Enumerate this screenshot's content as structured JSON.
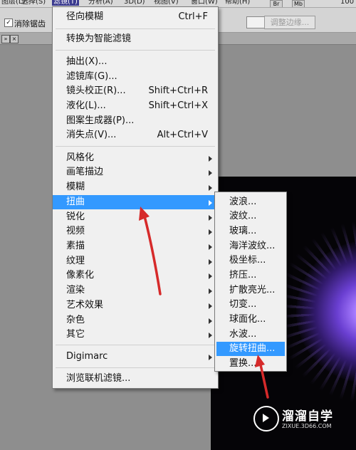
{
  "menubar": {
    "items": [
      "图层(L)",
      "选择(S)",
      "滤镜(T)",
      "分析(A)",
      "3D(D)",
      "视图(V)",
      "窗口(W)",
      "帮助(H)"
    ],
    "zoom": "100"
  },
  "options_bar": {
    "antialias_label": "消除锯齿",
    "refine_edge_label": "调整边缘..."
  },
  "filter_menu": {
    "items": [
      {
        "label": "径向模糊",
        "shortcut": "Ctrl+F"
      },
      {
        "label": "转换为智能滤镜"
      },
      {
        "label": "抽出(X)..."
      },
      {
        "label": "滤镜库(G)..."
      },
      {
        "label": "镜头校正(R)...",
        "shortcut": "Shift+Ctrl+R"
      },
      {
        "label": "液化(L)...",
        "shortcut": "Shift+Ctrl+X"
      },
      {
        "label": "图案生成器(P)..."
      },
      {
        "label": "消失点(V)...",
        "shortcut": "Alt+Ctrl+V"
      },
      {
        "label": "风格化"
      },
      {
        "label": "画笔描边"
      },
      {
        "label": "模糊"
      },
      {
        "label": "扭曲"
      },
      {
        "label": "锐化"
      },
      {
        "label": "视频"
      },
      {
        "label": "素描"
      },
      {
        "label": "纹理"
      },
      {
        "label": "像素化"
      },
      {
        "label": "渲染"
      },
      {
        "label": "艺术效果"
      },
      {
        "label": "杂色"
      },
      {
        "label": "其它"
      },
      {
        "label": "Digimarc"
      },
      {
        "label": "浏览联机滤镜..."
      }
    ],
    "highlighted": "扭曲"
  },
  "distort_submenu": {
    "items": [
      "波浪...",
      "波纹...",
      "玻璃...",
      "海洋波纹...",
      "极坐标...",
      "挤压...",
      "扩散亮光...",
      "切变...",
      "球面化...",
      "水波...",
      "旋转扭曲...",
      "置换..."
    ],
    "highlighted": "旋转扭曲..."
  },
  "watermark": {
    "name": "溜溜自学",
    "url": "ZIXUE.3D66.COM"
  },
  "colors": {
    "highlight": "#3399ff",
    "arrow": "#d62a2a",
    "menu_bg": "#f0f0f0"
  },
  "icons": [
    "close-icon",
    "submenu-arrow-icon",
    "checkbox-icon",
    "play-icon"
  ]
}
